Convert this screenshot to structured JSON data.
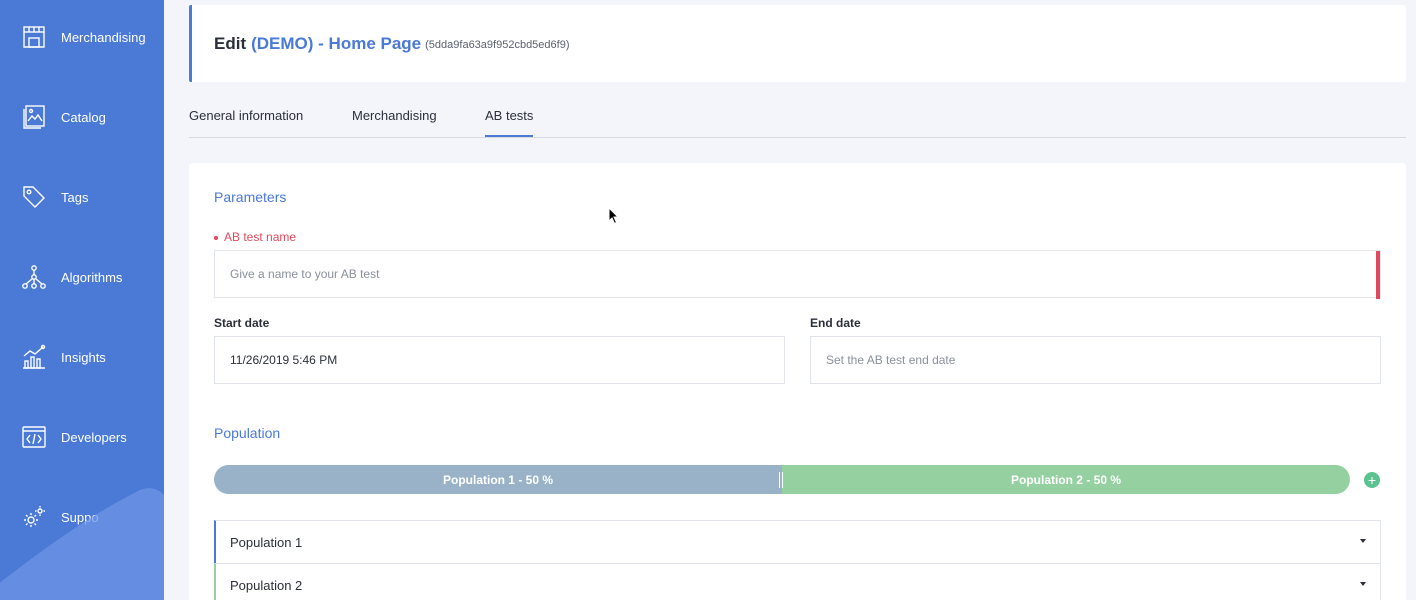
{
  "sidebar": {
    "items": [
      {
        "label": "Merchandising",
        "icon": "store-icon"
      },
      {
        "label": "Catalog",
        "icon": "catalog-icon"
      },
      {
        "label": "Tags",
        "icon": "tag-icon"
      },
      {
        "label": "Algorithms",
        "icon": "algorithm-icon"
      },
      {
        "label": "Insights",
        "icon": "chart-icon"
      },
      {
        "label": "Developers",
        "icon": "code-icon"
      },
      {
        "label": "Suppo",
        "icon": "gear-icon"
      }
    ]
  },
  "header": {
    "edit_label": "Edit",
    "page_name": "(DEMO) - Home Page",
    "page_id": "(5dda9fa63a9f952cbd5ed6f9)"
  },
  "tabs": [
    {
      "label": "General information"
    },
    {
      "label": "Merchandising"
    },
    {
      "label": "AB tests"
    }
  ],
  "parameters": {
    "title": "Parameters",
    "name_label": "AB test name",
    "name_placeholder": "Give a name to your AB test",
    "start_label": "Start date",
    "start_value": "11/26/2019 5:46 PM",
    "end_label": "End date",
    "end_placeholder": "Set the AB test end date"
  },
  "population": {
    "title": "Population",
    "bar": [
      {
        "label": "Population 1 - 50 %",
        "percent": 50
      },
      {
        "label": "Population 2 - 50 %",
        "percent": 50
      }
    ],
    "add_symbol": "+",
    "items": [
      {
        "label": "Population 1"
      },
      {
        "label": "Population 2"
      }
    ]
  },
  "colors": {
    "accent": "#4a79d6",
    "sidebar": "#4a79d6",
    "required": "#e0495b",
    "population1": "#9ab2c7",
    "population2": "#95d1a0"
  }
}
